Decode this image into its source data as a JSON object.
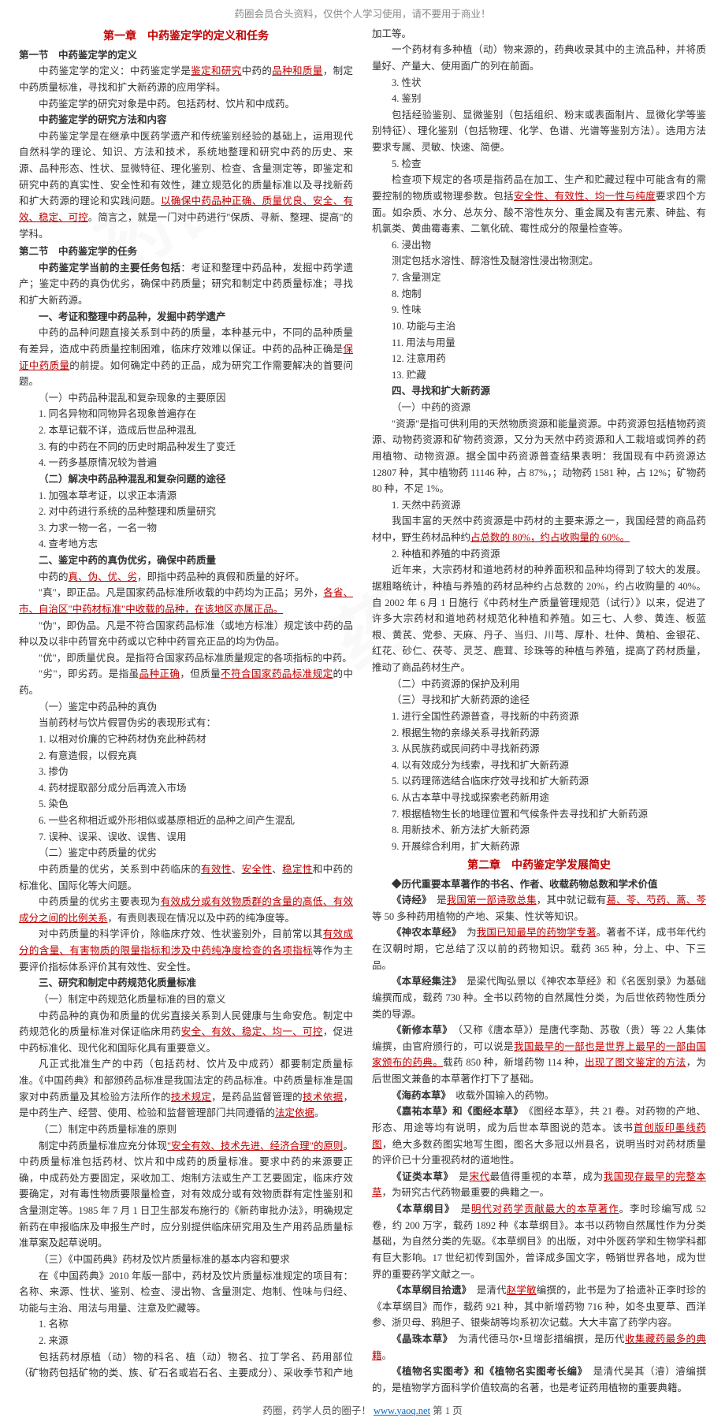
{
  "header": "药圈会员合头资料，仅供个人学习使用，请不要用于商业！",
  "footer_prefix": "药圈，药学人员的圈子！ ",
  "footer_url": "www.yaoq.net",
  "footer_suffix": " 第  1  页",
  "watermark": "药圈",
  "ch1_title": "第一章　中药鉴定学的定义和任务",
  "s1_1": "第一节　中药鉴定学的定义",
  "p1a": "中药鉴定学的定义：中药鉴定学是",
  "p1b": "鉴定和研究",
  "p1c": "中药的",
  "p1d": "品种和质量",
  "p1e": "，制定中药质量标准，寻找和扩大新药源的应用学科。",
  "p2": "中药鉴定学的研究对象是中药。包括药材、饮片和中成药。",
  "h_method": "中药鉴定学的研究方法和内容",
  "p3a": "中药鉴定学是在继承中医药学遗产和传统鉴别经验的基础上，运用现代自然科学的理论、知识、方法和技术，系统地整理和研究中药的历史、来源、品种形态、性状、显微特征、理化鉴别、检查、含量测定等，即鉴定和研究中药的真实性、安全性和有效性，建立规范化的质量标准以及寻找新药和扩大药源的理论和实践问题。",
  "p3b": "以确保中药品种正确、质量优良、安全、有效、稳定、可控",
  "p3c": "。简言之，就是一门对中药进行\"保质、寻新、整理、提高\"的学科。",
  "s1_2": "第二节　中药鉴定学的任务",
  "p4a": "中药鉴定学当前的主要任务包括",
  "p4b": "：考证和整理中药品种，发掘中药学遗产；鉴定中药的真伪优劣，确保中药质量；研究和制定中药质量标准；寻找和扩大新药源。",
  "h_1": "一、考证和整理中药品种，发掘中药学遗产",
  "p5a": "中药的品种问题直接关系到中药的质量，本种基元中，不同的品种质量有差异，造成中药质量控制困难，临床疗效难以保证。中药的品种正确是",
  "p5b": "保证中药质量",
  "p5c": "的前提。如何确定中药的正品，成为研究工作需要解决的首要问题。",
  "h_1_1": "（一）中药品种混乱和复杂现象的主要原因",
  "li1_1": "1. 同名异物和同物异名现象普遍存在",
  "li1_2": "2. 本草记载不详，造成后世品种混乱",
  "li1_3": "3. 有的中药在不同的历史时期品种发生了变迁",
  "li1_4": "4. 一药多基原情况较为普遍",
  "h_1_2": "（二）解决中药品种混乱和复杂问题的途径",
  "li2_1": "1. 加强本草考证，以求正本清源",
  "li2_2": "2. 对中药进行系统的品种整理和质量研究",
  "li2_3": "3. 力求一物一名，一名一物",
  "li2_4": "4. 查考地方志",
  "h_2": "二、鉴定中药的真伪优劣，确保中药质量",
  "p6a": "中药的",
  "p6b": "真、伪、优、劣",
  "p6c": "，即指中药品种的真假和质量的好坏。",
  "p7a": "\"真\"，即正品。凡是国家药品标准所收载的中药均为正品；另外，",
  "p7b": "各省、市、自治区\"中药材标准\"中收载的品种，在该地区亦属正品。",
  "p8": "\"伪\"，即伪品。凡是不符合国家药品标准（或地方标准）规定该中药的品种以及以非中药冒充中药或以它种中药冒充正品的均为伪品。",
  "p9": "\"优\"，即质量优良。是指符合国家药品标准质量规定的各项指标的中药。",
  "p10a": "\"劣\"，即劣药。是指虽",
  "p10b": "品种正确",
  "p10c": "，但质量",
  "p10d": "不符合国家药品标准规定",
  "p10e": "的中药。",
  "h_2_1": "（一）鉴定中药品种的真伪",
  "p11": "当前药材与饮片假冒伪劣的表现形式有：",
  "li3_1": "1. 以相对价廉的它种药材伪充此种药材",
  "li3_2": "2. 有意造假，以假充真",
  "li3_3": "3. 掺伪",
  "li3_4": "4. 药材提取部分成分后再流入市场",
  "li3_5": "5. 染色",
  "li3_6": "6. 一些名称相近或外形相似或基原相近的品种之间产生混乱",
  "li3_7": "7. 误种、误采、误收、误售、误用",
  "h_2_2": "（二）鉴定中药质量的优劣",
  "p12a": "中药质量的优劣，关系到中药临床的",
  "p12b": "有效性",
  "p12c": "、",
  "p12d": "安全性",
  "p12e": "、",
  "p12f": "稳定性",
  "p12g": "和中药的标准化、国际化等大问题。",
  "p13a": "中药质量的优劣主要表现为",
  "p13b": "有效成分或有效物质群的含量的高低、有效成分之间的比例关系",
  "p13c": "，有责则表现在情况以及中药的纯净度等。",
  "p14a": "对中药质量的科学评价，除临床疗效、性状鉴别外，目前常以其",
  "p14b": "有效成分的含量、有害物质的限量指标和涉及中药纯净度检查的各项指标",
  "p14c": "等作为主要评价指标体系评价其有效性、安全性。",
  "h_3": "三、研究和制定中药规范化质量标准",
  "h_3_1": "（一）制定中药规范化质量标准的目的意义",
  "p15a": "中药品种的真伪和质量的优劣直接关系到人民健康与生命安危。制定中药规范化的质量标准对保证临床用药",
  "p15b": "安全、有效、稳定、均一、可控",
  "p15c": "，促进中药标准化、现代化和国际化具有重要意义。",
  "p16a": "凡正式批准生产的中药（包括药材、饮片及中成药）都要制定质量标准。《中国药典》和部颁药品标准是我国法定的药品标准。中药质量标准是国家对中药质量及其检验方法所作的",
  "p16b": "技术规定",
  "p16c": "，是药品监督管理的",
  "p16d": "技术依据",
  "p16e": "，是中药生产、经营、使用、检验和监督管理部门共同遵循的",
  "p16f": "法定依据",
  "p16g": "。",
  "h_3_2": "（二）制定中药质量标准的原则",
  "p17a": "制定中药质量标准应充分体现",
  "p17b": "\"安全有效、技术先进、经济合理\"的原则",
  "p17c": "。中药质量标准包括药材、饮片和中成药的质量标准。要求中药的来源要正确，中成药处方要固定，采收加工、炮制方法或生产工艺要固定，临床疗效要确定，对有毒性物质要限量检查，对有效成分或有效物质群有定性鉴别和含量测定等。1985 年 7 月 1 日卫生部发布施行的《新药审批办法》，明确规定新药在申报临床及申报生产时，应分别提供临床研究用及生产用药品质量标准草案及起草说明。",
  "h_3_3": "（三）《中国药典》药材及饮片质量标准的基本内容和要求",
  "p18": "在《中国药典》2010 年版一部中，药材及饮片质量标准规定的项目有：名称、来源、性状、鉴别、检查、浸出物、含量测定、炮制、性味与归经、功能与主治、用法与用量、注意及贮藏等。",
  "r1": "1. 名称",
  "r2": "2. 来源",
  "r2p": "包括药材原植（动）物的科名、植（动）物名、拉丁学名、药用部位（矿物药包括矿物的类、族、矿石名或岩石名、主要成分）、采收季节和产地加工等。",
  "r2p2": "一个药材有多种植（动）物来源的，药典收录其中的主流品种，并将质量好、产量大、使用面广的列在前面。",
  "r3": "3. 性状",
  "r4": "4. 鉴别",
  "r4p": "包括经验鉴别、显微鉴别（包括组织、粉末或表面制片、显微化学等鉴别特征）、理化鉴别（包括物理、化学、色谱、光谱等鉴别方法）。选用方法要求专属、灵敏、快速、简便。",
  "r5": "5. 检查",
  "r5p": "检查项下规定的各项是指药品在加工、生产和贮藏过程中可能含有的需要控制的物质或物理参数。包括",
  "r5b": "安全性、有效性、均一性与纯度",
  "r5c": "要求四个方面。如杂质、水分、总灰分、酸不溶性灰分、重金属及有害元素、砷盐、有机氯类、黄曲霉毒素、二氧化硫、霉性成分的限量检查等。",
  "r6": "6. 浸出物",
  "r6p": "测定包括水溶性、醇溶性及醚溶性浸出物测定。",
  "r7": "7. 含量测定",
  "r8": "8. 炮制",
  "r9": "9. 性味",
  "r10": "10. 功能与主治",
  "r11": "11. 用法与用量",
  "r12": "12. 注意用药",
  "r13": "13. 贮藏",
  "h_4": "四、寻找和扩大新药源",
  "h_4_1": "（一）中药的资源",
  "p19": "\"资源\"是指可供利用的天然物质资源和能量资源。中药资源包括植物药资源、动物药资源和矿物药资源，又分为天然中药资源和人工栽培或饲养的药用植物、动物资源。据全国中药资源普查结果表明：我国现有中药资源达 12807 种，其中植物药 11146 种，占 87%，；动物药 1581 种，占 12%；矿物药 80 种，不足 1%。",
  "li4_1": "1. 天然中药资源",
  "p20a": "我国丰富的天然中药资源是中药材的主要来源之一，我国经营的商品药材中，野生药材品种约",
  "p20b": "占总数的 80%，约占收购量的 60%。",
  "li4_2": "2. 种植和养殖的中药资源",
  "p21": "近年来，大宗药材和道地药材的种养面积和品种均得到了较大的发展。据粗略统计，种植与养殖的药材品种约占总数的 20%，约占收购量的 40%。自 2002 年 6 月 1 日施行《中药材生产质量管理规范（试行）》以来，促进了许多大宗药材和道地药材规范化种植和养殖。如三七、人参、黄连、板蓝根、黄芪、党参、天麻、丹子、当归、川芎、厚朴、杜仲、黄柏、金银花、红花、砂仁、茯苓、灵芝、鹿茸、珍珠等的种植与养殖，提高了药材质量，推动了商品药材生产。",
  "h_4_2": "（二）中药资源的保护及利用",
  "h_4_3": "（三）寻找和扩大新药源的途径",
  "li5_1": "1. 进行全国性药源普查，寻找新的中药资源",
  "li5_2": "2. 根据生物的亲缘关系寻找新药源",
  "li5_3": "3. 从民族药或民间药中寻找新药源",
  "li5_4": "4. 以有效成分为线索，寻找和扩大新药源",
  "li5_5": "5. 以药理筛选结合临床疗效寻找和扩大新药源",
  "li5_6": "6. 从古本草中寻找或探索老药新用途",
  "li5_7": "7. 根据植物生长的地理位置和气候条件去寻找和扩大新药源",
  "li5_8": "8. 用新技术、新方法扩大新药源",
  "li5_9": "9. 开展综合利用，扩大新药源",
  "ch2_title": "第二章　中药鉴定学发展简史",
  "h_diamond": "◆历代重要本草著作的书名、作者、收载药物总数和学术价值",
  "b1a": "《诗经》",
  "b1b": "　是",
  "b1c": "我国第一部诗歌总集",
  "b1d": "，其中就记载有",
  "b1e": "葛、苓、芍药、蒿、芩",
  "b1f": "等 50 多种药用植物的产地、采集、性状等知识。",
  "b2a": "《神农本草经》",
  "b2b": "　为",
  "b2c": "我国已知最早的药物学专著",
  "b2d": "。著者不详，成书年代约在汉朝时期，它总结了汉以前的药物知识。载药 365 种，分上、中、下三品。",
  "b3a": "《本草经集注》",
  "b3b": "　是梁代陶弘景以《神农本草经》和《名医别录》为基础编撰而成，载药 730 种。全书以药物的自然属性分类，为后世依药物性质分类的导源。",
  "b4a": "《新修本草》",
  "b4b": "　（又称《唐本草》）是唐代李勣、苏敬（贵）等 22 人集体编撰，由官府颁行的，可以说是",
  "b4c": "我国最早的一部也是世界上最早的一部由国家颁布的药典。",
  "b4d": "载药 850 种，新增药物 114 种，",
  "b4e": "出现了图文鉴定的方法",
  "b4f": "，为后世图文兼备的本草著作打下了基础。",
  "b5a": "《海药本草》",
  "b5b": "　收载外国输入的药物。",
  "b6a": "《嘉祐本草》和《图经本草》",
  "b6b": "　《图经本草》，共 21 卷。对药物的产地、形态、用途等均有说明，成为后世本草图说的范本。该书",
  "b6c": "首创版印墨线药图",
  "b6d": "，绝大多数药图实地写生图，图名大多冠以州县名，说明当时对药材质量的评价已十分重视药材的道地性。",
  "b7a": "《证类本草》",
  "b7b": "　是",
  "b7c": "宋代",
  "b7d": "最值得重视的本草，成为",
  "b7e": "我国现存最早的完整本草",
  "b7f": "，为研究古代药物最重要的典籍之一。",
  "b8a": "《本草纲目》",
  "b8b": "　是",
  "b8c": "明代对药学贡献最大的本草著作",
  "b8d": "。李时珍编写成 52 卷，约 200 万字，载药 1892 种《本草纲目》。本书以药物自然属性作为分类基础，为自然分类的先驱。《本草纲目》的出版，对中外医药学和生物学科都有巨大影响。17 世纪初传到国外，曾译成多国文字，畅销世界各地，成为世界的重要药学文献之一。",
  "b9a": "《本草纲目拾遗》",
  "b9b": "　是清代",
  "b9c": "赵学敏",
  "b9d": "编撰的，此书是为了拾遗补正李时珍的《本草纲目》而作，载药 921 种，其中新增药物 716 种，如冬虫夏草、西洋参、浙贝母、鸦胆子、银柴胡等均系初次记载。大大丰富了药学内容。",
  "b10a": "《晶珠本草》",
  "b10b": "　为清代德马尔•旦增彭措编撰，是历代",
  "b10c": "收集藏药最多的典籍",
  "b10d": "。",
  "b11a": "《植物名实图考》和《植物名实图考长编》",
  "b11b": "　是清代吴其（濬）濬编撰的，是植物学方面科学价值较高的名著，也是考证药用植物的重要典籍。"
}
